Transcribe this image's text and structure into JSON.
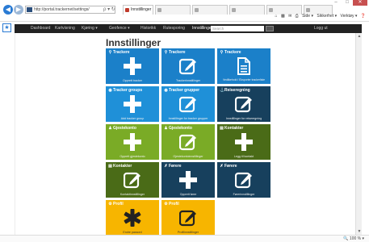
{
  "browser": {
    "address": "http://portal.trackernet/settings/",
    "address_tools": "ρ ▾ ↻",
    "tabs": [
      {
        "label": "Innstillinger",
        "active": true
      },
      {
        "label": "",
        "active": false
      },
      {
        "label": "",
        "active": false
      },
      {
        "label": "",
        "active": false
      },
      {
        "label": "",
        "active": false
      },
      {
        "label": "",
        "active": false
      }
    ],
    "toolbar_right": [
      "Side ▾",
      "Sikkerhet ▾",
      "Verktøy ▾"
    ],
    "window_controls": [
      "–",
      "□",
      "✕"
    ]
  },
  "appnav": {
    "items": [
      "Dashboard",
      "Kartvisning",
      "Kjøring ▾",
      "Geofence ▾",
      "Historikk",
      "Rutesporing",
      "Innstillinger"
    ],
    "active_index": 6,
    "search_placeholder": "Search",
    "login": "Logg ut"
  },
  "page": {
    "title": "Innstillinger"
  },
  "tiles": [
    {
      "title": "Trackere",
      "icon": "plus",
      "header_icon": "map-pin",
      "caption": "Opprett tracker",
      "color": "blue"
    },
    {
      "title": "Trackere",
      "icon": "edit",
      "header_icon": "map-pin",
      "caption": "Trackerinnstillinger",
      "color": "blue"
    },
    {
      "title": "Trackere",
      "icon": "document",
      "header_icon": "map-pin",
      "caption": "Vedlikehold / Eksporter trackerliste",
      "color": "blue"
    },
    {
      "title": "Tracker groups",
      "icon": "plus",
      "header_icon": "eye",
      "caption": "Add tracker group",
      "color": "blue"
    },
    {
      "title": "Tracker grupper",
      "icon": "edit",
      "header_icon": "eye",
      "caption": "Innstillinger for tracker grupper",
      "color": "blue"
    },
    {
      "title": "Reiseregning",
      "icon": "edit",
      "header_icon": "car",
      "caption": "Innstillinger for reiseregning",
      "color": "dblue"
    },
    {
      "title": "Gjestekonto",
      "icon": "plus",
      "header_icon": "user",
      "caption": "Opprett gjestekonto",
      "color": "green"
    },
    {
      "title": "Gjestekonto",
      "icon": "edit",
      "header_icon": "user",
      "caption": "Gjestekontoinnstillinger",
      "color": "green"
    },
    {
      "title": "Kontakter",
      "icon": "plus",
      "header_icon": "card",
      "caption": "Legg til kontakt",
      "color": "dgreen"
    },
    {
      "title": "Kontakter",
      "icon": "edit",
      "header_icon": "card",
      "caption": "Kontaktinnstillinger",
      "color": "dgreen"
    },
    {
      "title": "Førere",
      "icon": "plus",
      "header_icon": "wrench",
      "caption": "Opprett fører",
      "color": "dblue"
    },
    {
      "title": "Førere",
      "icon": "edit",
      "header_icon": "wrench",
      "caption": "Førerinnstillinger",
      "color": "dblue"
    },
    {
      "title": "Profil",
      "icon": "asterisk",
      "header_icon": "gear",
      "caption": "Endre passord",
      "color": "yellow"
    },
    {
      "title": "Profil",
      "icon": "edit",
      "header_icon": "gear",
      "caption": "Profilinnstillinger",
      "color": "yellow"
    }
  ],
  "status_bar": {
    "zoom": "🔍 100 % ▾"
  }
}
